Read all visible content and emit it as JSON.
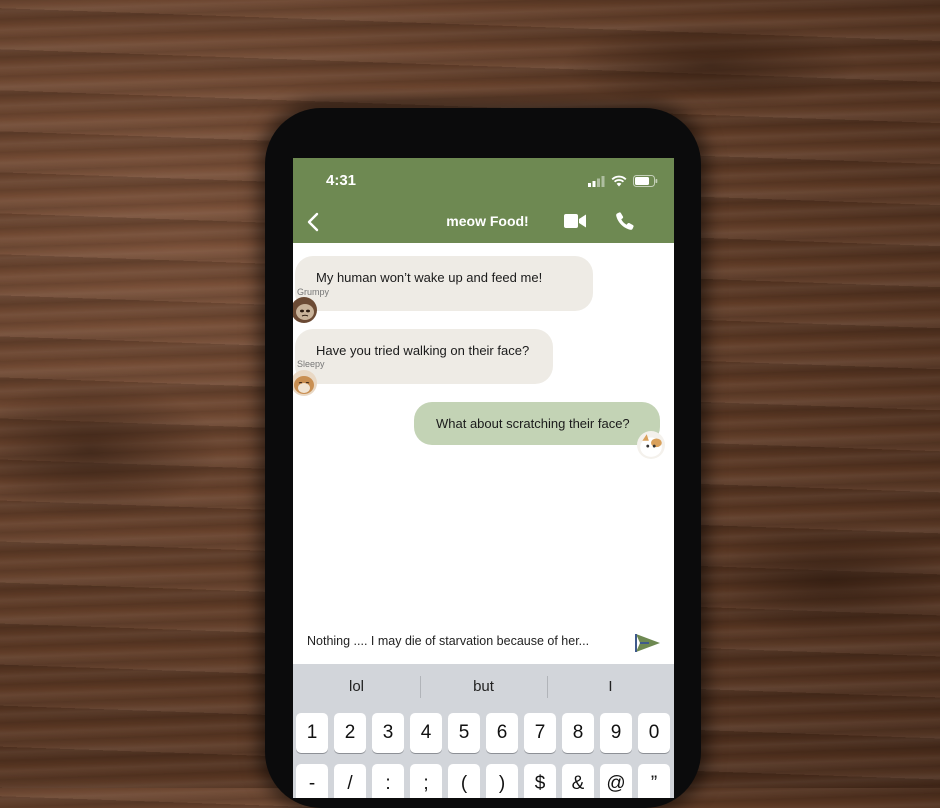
{
  "status_bar": {
    "time": "4:31"
  },
  "header": {
    "title": "meow Food!",
    "icons": [
      "back-chevron-icon",
      "video-camera-icon",
      "phone-icon"
    ]
  },
  "messages": [
    {
      "direction": "incoming",
      "sender": "Grumpy",
      "text": "My human won’t wake up and feed me!"
    },
    {
      "direction": "incoming",
      "sender": "Sleepy",
      "text": "Have you tried walking on their face?"
    },
    {
      "direction": "outgoing",
      "text": "What about scratching their face?"
    }
  ],
  "composer": {
    "value": "Nothing .... I  may die of starvation because of her..."
  },
  "keyboard": {
    "suggestions": [
      "lol",
      "but",
      "I"
    ],
    "row1": [
      "1",
      "2",
      "3",
      "4",
      "5",
      "6",
      "7",
      "8",
      "9",
      "0"
    ],
    "row2": [
      "-",
      "/",
      ":",
      ";",
      "(",
      ")",
      "$",
      "&",
      "@",
      "”"
    ]
  },
  "colors": {
    "accent": "#6e8952",
    "incoming_bubble": "#eeebe5",
    "outgoing_bubble": "#c3d3b5",
    "keyboard_bg": "#d2d5da"
  }
}
